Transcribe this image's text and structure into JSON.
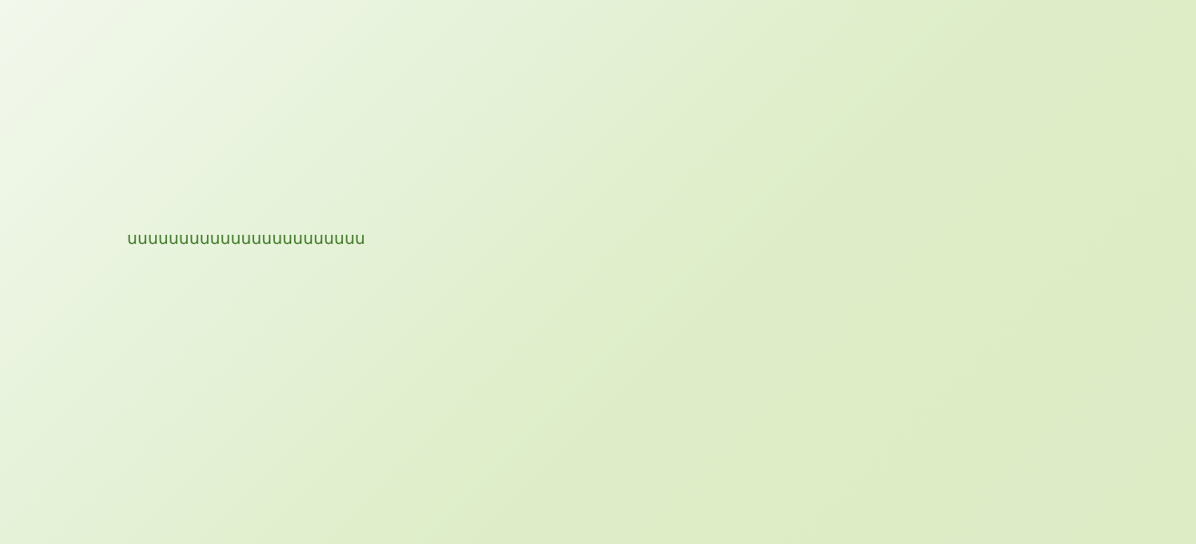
{
  "content": {
    "text": "uuuuuuuuuuuuuuuuuuuuuuu"
  },
  "colors": {
    "text": "#3f7a26",
    "background_start": "#f2f8ec",
    "background_end": "#ddecc5"
  }
}
